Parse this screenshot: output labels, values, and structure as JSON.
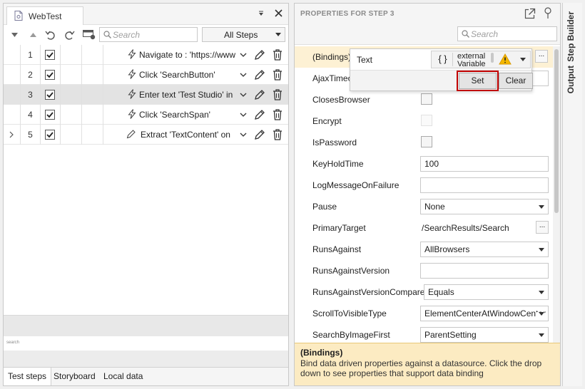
{
  "doc": {
    "tab_title": "WebTest"
  },
  "toolbar": {
    "search_placeholder": "Search",
    "filter_selected": "All Steps"
  },
  "steps": [
    {
      "num": "1",
      "desc": "Navigate to : 'https://www.",
      "icon": "lightning-icon",
      "expandable": false,
      "selected": false
    },
    {
      "num": "2",
      "desc": "Click 'SearchButton'",
      "icon": "lightning-icon",
      "expandable": false,
      "selected": false
    },
    {
      "num": "3",
      "desc": "Enter text 'Test Studio' in",
      "icon": "lightning-icon",
      "expandable": false,
      "selected": true
    },
    {
      "num": "4",
      "desc": "Click 'SearchSpan'",
      "icon": "lightning-icon",
      "expandable": false,
      "selected": false
    },
    {
      "num": "5",
      "desc": "Extract 'TextContent' on",
      "icon": "pencil-icon",
      "expandable": true,
      "selected": false
    }
  ],
  "mini_search": {
    "label": "search"
  },
  "bottom_tabs": [
    "Test steps",
    "Storyboard",
    "Local data"
  ],
  "props": {
    "title": "PROPERTIES FOR STEP 3",
    "search_placeholder": "Search",
    "rows": {
      "bindings": {
        "name": "(Bindings)"
      },
      "ajax": {
        "name": "AjaxTimeout"
      },
      "closes": {
        "name": "ClosesBrowser"
      },
      "encrypt": {
        "name": "Encrypt"
      },
      "ispassword": {
        "name": "IsPassword"
      },
      "keyhold": {
        "name": "KeyHoldTime",
        "value": "100"
      },
      "logmsg": {
        "name": "LogMessageOnFailure",
        "value": ""
      },
      "pause": {
        "name": "Pause",
        "value": "None"
      },
      "primary": {
        "name": "PrimaryTarget",
        "value": "/SearchResults/Search"
      },
      "runs": {
        "name": "RunsAgainst",
        "value": "AllBrowsers"
      },
      "runsver": {
        "name": "RunsAgainstVersion",
        "value": ""
      },
      "runsvercmp": {
        "name": "RunsAgainstVersionCompare",
        "value": "Equals"
      },
      "scroll": {
        "name": "ScrollToVisibleType",
        "value": "ElementCenterAtWindowCenter"
      },
      "searchimg": {
        "name": "SearchByImageFirst",
        "value": "ParentSetting"
      }
    },
    "ellipsis_label": "...",
    "description": {
      "title": "(Bindings)",
      "text": "Bind data driven properties against a datasource. Click the drop down to see properties that support data binding"
    }
  },
  "binding_popup": {
    "property": "Text",
    "braces": "{ }",
    "variable": "externalVariable",
    "set_label": "Set",
    "clear_label": "Clear"
  },
  "side_tabs": {
    "step_builder": "Step Builder",
    "output": "Output"
  },
  "colors": {
    "accent_outline": "#c00000",
    "warning": "#f5b800",
    "selected_row": "#e3e3e3",
    "bindings_row": "#fdf1d4",
    "description_bg": "#fcebc2"
  }
}
